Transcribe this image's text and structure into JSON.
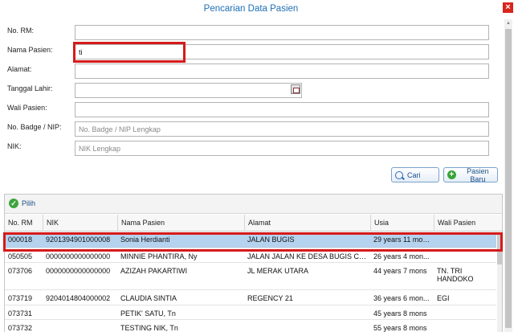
{
  "dialog": {
    "title": "Pencarian Data Pasien",
    "close_label": "×"
  },
  "form": {
    "no_rm": {
      "label": "No. RM:",
      "value": "",
      "placeholder": ""
    },
    "nama_pasien": {
      "label": "Nama Pasien:",
      "value": "ti",
      "placeholder": ""
    },
    "alamat": {
      "label": "Alamat:",
      "value": "",
      "placeholder": ""
    },
    "tanggal_lahir": {
      "label": "Tanggal Lahir:",
      "value": "",
      "placeholder": ""
    },
    "wali_pasien": {
      "label": "Wali Pasien:",
      "value": "",
      "placeholder": ""
    },
    "no_badge": {
      "label": "No. Badge / NIP:",
      "value": "",
      "placeholder": "No. Badge / NIP Lengkap"
    },
    "nik": {
      "label": "NIK:",
      "value": "",
      "placeholder": "NIK Lengkap"
    }
  },
  "buttons": {
    "cari": "Cari",
    "pasien_baru": "Pasien Baru"
  },
  "grid": {
    "pilih_label": "Pilih",
    "columns": [
      "No. RM",
      "NIK",
      "Nama Pasien",
      "Alamat",
      "Usia",
      "Wali Pasien"
    ],
    "rows": [
      {
        "no_rm": "000018",
        "nik": "9201394901000008",
        "nama": "Sonia Herdianti",
        "alamat": "JALAN BUGIS",
        "usia": "29 years 11 mon...",
        "wali": "",
        "selected": true
      },
      {
        "no_rm": "050505",
        "nik": "0000000000000000",
        "nama": "MINNIE PHANTIRA, Ny",
        "alamat": "JALAN JALAN KE DESA BUGIS CA...",
        "usia": "26 years 4 mon...",
        "wali": "",
        "selected": false
      },
      {
        "no_rm": "073706",
        "nik": "0000000000000000",
        "nama": "AZIZAH PAKARTIWI",
        "alamat": "JL MERAK UTARA",
        "usia": "44 years 7 mons",
        "wali": "TN. TRI HANDOKO",
        "selected": false
      },
      {
        "no_rm": "073719",
        "nik": "9204014804000002",
        "nama": "CLAUDIA SINTIA",
        "alamat": "REGENCY 21",
        "usia": "36 years 6 mon...",
        "wali": "EGI",
        "selected": false
      },
      {
        "no_rm": "073731",
        "nik": "",
        "nama": "PETIK' SATU, Tn",
        "alamat": "",
        "usia": "45 years 8 mons",
        "wali": "",
        "selected": false
      },
      {
        "no_rm": "073732",
        "nik": "",
        "nama": "TESTING NIK, Tn",
        "alamat": "",
        "usia": "55 years 8 mons",
        "wali": "",
        "selected": false
      }
    ]
  }
}
